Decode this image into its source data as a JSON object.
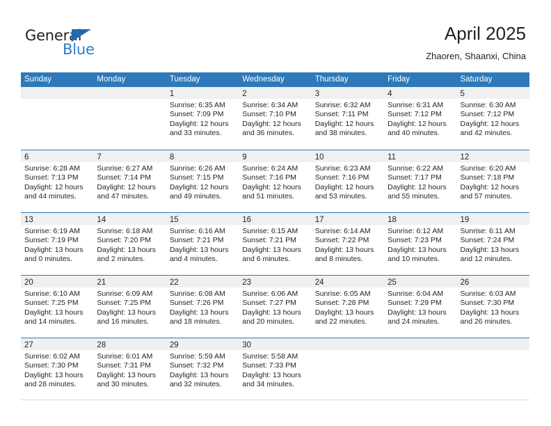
{
  "brand": {
    "name_part1": "General",
    "name_part2": "Blue",
    "triangle_color": "#1e69b0",
    "blue_color": "#2b7ec1"
  },
  "header": {
    "title": "April 2025",
    "subtitle": "Zhaoren, Shaanxi, China"
  },
  "theme": {
    "header_bg": "#2e79b9",
    "header_text": "#ffffff",
    "day_band_bg": "#f0f0f0",
    "row_border": "#2e79b9",
    "text": "#231f20"
  },
  "weekdays": [
    "Sunday",
    "Monday",
    "Tuesday",
    "Wednesday",
    "Thursday",
    "Friday",
    "Saturday"
  ],
  "labels": {
    "sunrise_prefix": "Sunrise:",
    "sunset_prefix": "Sunset:",
    "daylight_prefix": "Daylight:"
  },
  "weeks": [
    [
      {
        "day": "",
        "sunrise": "",
        "sunset": "",
        "daylight": ""
      },
      {
        "day": "",
        "sunrise": "",
        "sunset": "",
        "daylight": ""
      },
      {
        "day": "1",
        "sunrise": "Sunrise: 6:35 AM",
        "sunset": "Sunset: 7:09 PM",
        "daylight": "Daylight: 12 hours and 33 minutes."
      },
      {
        "day": "2",
        "sunrise": "Sunrise: 6:34 AM",
        "sunset": "Sunset: 7:10 PM",
        "daylight": "Daylight: 12 hours and 36 minutes."
      },
      {
        "day": "3",
        "sunrise": "Sunrise: 6:32 AM",
        "sunset": "Sunset: 7:11 PM",
        "daylight": "Daylight: 12 hours and 38 minutes."
      },
      {
        "day": "4",
        "sunrise": "Sunrise: 6:31 AM",
        "sunset": "Sunset: 7:12 PM",
        "daylight": "Daylight: 12 hours and 40 minutes."
      },
      {
        "day": "5",
        "sunrise": "Sunrise: 6:30 AM",
        "sunset": "Sunset: 7:12 PM",
        "daylight": "Daylight: 12 hours and 42 minutes."
      }
    ],
    [
      {
        "day": "6",
        "sunrise": "Sunrise: 6:28 AM",
        "sunset": "Sunset: 7:13 PM",
        "daylight": "Daylight: 12 hours and 44 minutes."
      },
      {
        "day": "7",
        "sunrise": "Sunrise: 6:27 AM",
        "sunset": "Sunset: 7:14 PM",
        "daylight": "Daylight: 12 hours and 47 minutes."
      },
      {
        "day": "8",
        "sunrise": "Sunrise: 6:26 AM",
        "sunset": "Sunset: 7:15 PM",
        "daylight": "Daylight: 12 hours and 49 minutes."
      },
      {
        "day": "9",
        "sunrise": "Sunrise: 6:24 AM",
        "sunset": "Sunset: 7:16 PM",
        "daylight": "Daylight: 12 hours and 51 minutes."
      },
      {
        "day": "10",
        "sunrise": "Sunrise: 6:23 AM",
        "sunset": "Sunset: 7:16 PM",
        "daylight": "Daylight: 12 hours and 53 minutes."
      },
      {
        "day": "11",
        "sunrise": "Sunrise: 6:22 AM",
        "sunset": "Sunset: 7:17 PM",
        "daylight": "Daylight: 12 hours and 55 minutes."
      },
      {
        "day": "12",
        "sunrise": "Sunrise: 6:20 AM",
        "sunset": "Sunset: 7:18 PM",
        "daylight": "Daylight: 12 hours and 57 minutes."
      }
    ],
    [
      {
        "day": "13",
        "sunrise": "Sunrise: 6:19 AM",
        "sunset": "Sunset: 7:19 PM",
        "daylight": "Daylight: 13 hours and 0 minutes."
      },
      {
        "day": "14",
        "sunrise": "Sunrise: 6:18 AM",
        "sunset": "Sunset: 7:20 PM",
        "daylight": "Daylight: 13 hours and 2 minutes."
      },
      {
        "day": "15",
        "sunrise": "Sunrise: 6:16 AM",
        "sunset": "Sunset: 7:21 PM",
        "daylight": "Daylight: 13 hours and 4 minutes."
      },
      {
        "day": "16",
        "sunrise": "Sunrise: 6:15 AM",
        "sunset": "Sunset: 7:21 PM",
        "daylight": "Daylight: 13 hours and 6 minutes."
      },
      {
        "day": "17",
        "sunrise": "Sunrise: 6:14 AM",
        "sunset": "Sunset: 7:22 PM",
        "daylight": "Daylight: 13 hours and 8 minutes."
      },
      {
        "day": "18",
        "sunrise": "Sunrise: 6:12 AM",
        "sunset": "Sunset: 7:23 PM",
        "daylight": "Daylight: 13 hours and 10 minutes."
      },
      {
        "day": "19",
        "sunrise": "Sunrise: 6:11 AM",
        "sunset": "Sunset: 7:24 PM",
        "daylight": "Daylight: 13 hours and 12 minutes."
      }
    ],
    [
      {
        "day": "20",
        "sunrise": "Sunrise: 6:10 AM",
        "sunset": "Sunset: 7:25 PM",
        "daylight": "Daylight: 13 hours and 14 minutes."
      },
      {
        "day": "21",
        "sunrise": "Sunrise: 6:09 AM",
        "sunset": "Sunset: 7:25 PM",
        "daylight": "Daylight: 13 hours and 16 minutes."
      },
      {
        "day": "22",
        "sunrise": "Sunrise: 6:08 AM",
        "sunset": "Sunset: 7:26 PM",
        "daylight": "Daylight: 13 hours and 18 minutes."
      },
      {
        "day": "23",
        "sunrise": "Sunrise: 6:06 AM",
        "sunset": "Sunset: 7:27 PM",
        "daylight": "Daylight: 13 hours and 20 minutes."
      },
      {
        "day": "24",
        "sunrise": "Sunrise: 6:05 AM",
        "sunset": "Sunset: 7:28 PM",
        "daylight": "Daylight: 13 hours and 22 minutes."
      },
      {
        "day": "25",
        "sunrise": "Sunrise: 6:04 AM",
        "sunset": "Sunset: 7:29 PM",
        "daylight": "Daylight: 13 hours and 24 minutes."
      },
      {
        "day": "26",
        "sunrise": "Sunrise: 6:03 AM",
        "sunset": "Sunset: 7:30 PM",
        "daylight": "Daylight: 13 hours and 26 minutes."
      }
    ],
    [
      {
        "day": "27",
        "sunrise": "Sunrise: 6:02 AM",
        "sunset": "Sunset: 7:30 PM",
        "daylight": "Daylight: 13 hours and 28 minutes."
      },
      {
        "day": "28",
        "sunrise": "Sunrise: 6:01 AM",
        "sunset": "Sunset: 7:31 PM",
        "daylight": "Daylight: 13 hours and 30 minutes."
      },
      {
        "day": "29",
        "sunrise": "Sunrise: 5:59 AM",
        "sunset": "Sunset: 7:32 PM",
        "daylight": "Daylight: 13 hours and 32 minutes."
      },
      {
        "day": "30",
        "sunrise": "Sunrise: 5:58 AM",
        "sunset": "Sunset: 7:33 PM",
        "daylight": "Daylight: 13 hours and 34 minutes."
      },
      {
        "day": "",
        "sunrise": "",
        "sunset": "",
        "daylight": ""
      },
      {
        "day": "",
        "sunrise": "",
        "sunset": "",
        "daylight": ""
      },
      {
        "day": "",
        "sunrise": "",
        "sunset": "",
        "daylight": ""
      }
    ]
  ]
}
